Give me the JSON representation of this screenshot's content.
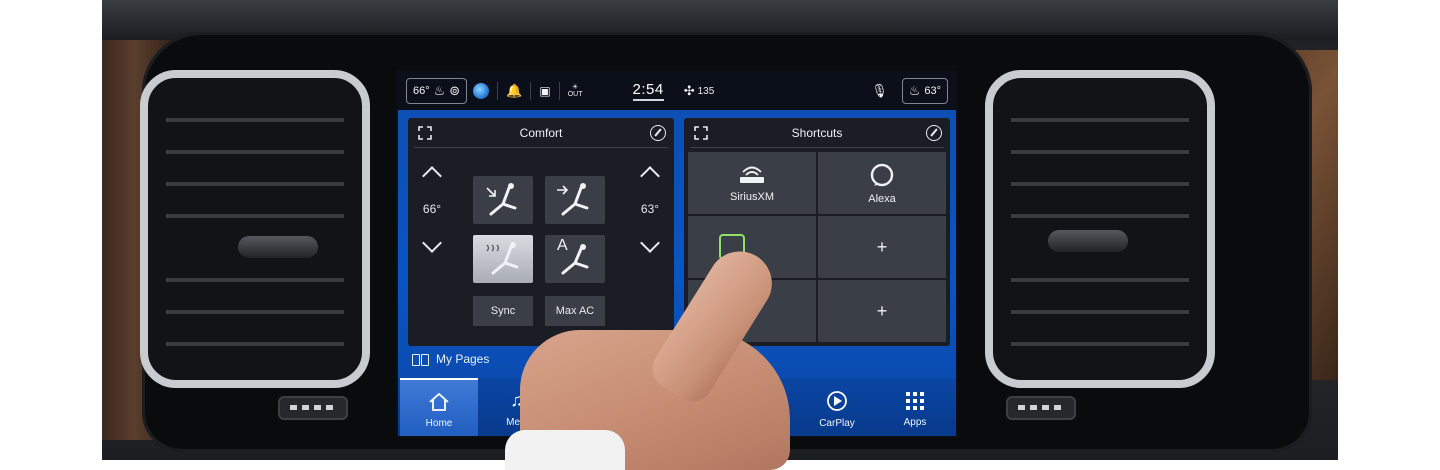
{
  "statusbar": {
    "driver_temp": "66°",
    "outside_label": "OUT",
    "clock": "2:54",
    "fan_value": "135",
    "passenger_temp": "63°"
  },
  "comfort": {
    "title": "Comfort",
    "driver_temp": "66°",
    "passenger_temp": "63°",
    "sync_label": "Sync",
    "maxac_label": "Max AC",
    "auto_label": "A"
  },
  "shortcuts": {
    "title": "Shortcuts",
    "tiles": [
      {
        "label": "SiriusXM"
      },
      {
        "label": "Alexa"
      },
      {
        "label": ""
      },
      {
        "label": "+"
      },
      {
        "label": "+"
      },
      {
        "label": "+"
      }
    ]
  },
  "mypages_label": "My Pages",
  "nav": [
    {
      "label": "Home"
    },
    {
      "label": "Medi"
    },
    {
      "label": "CarPlay"
    },
    {
      "label": "Apps"
    }
  ]
}
